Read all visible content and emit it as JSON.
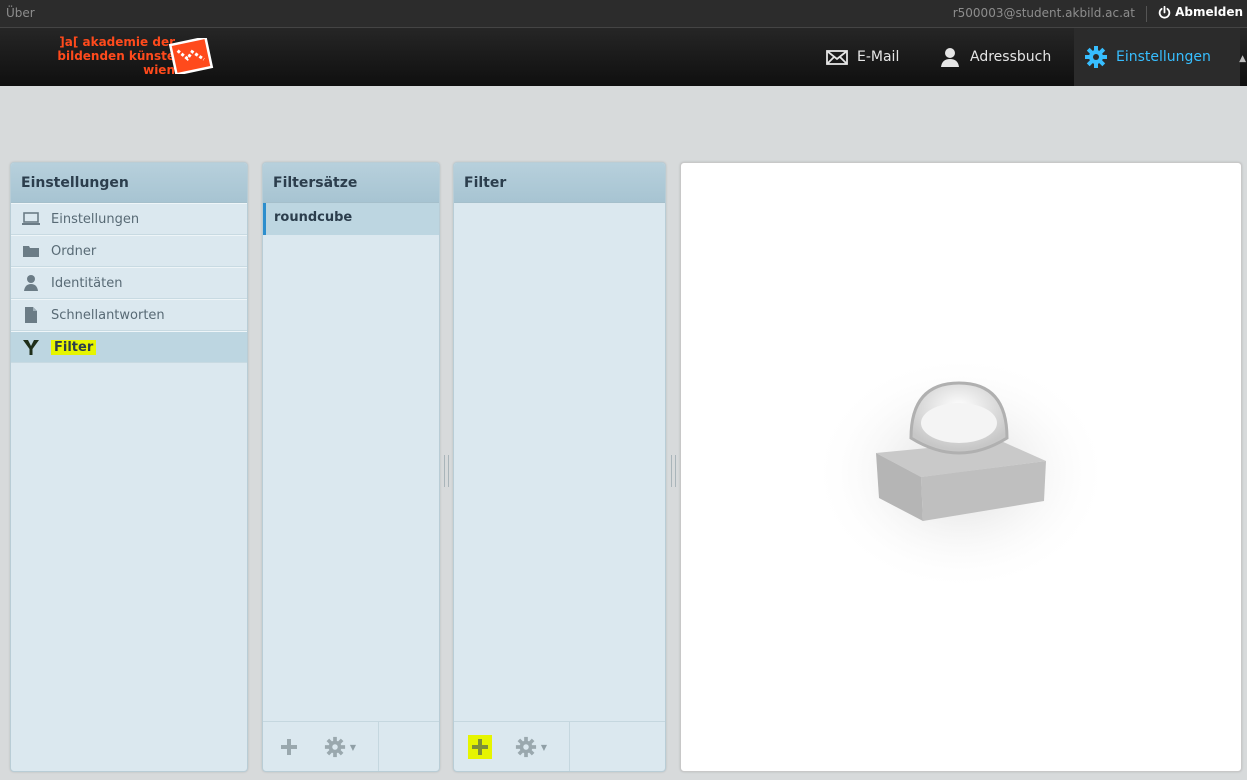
{
  "topbar": {
    "about_label": "Über",
    "user_email": "r500003@student.akbild.ac.at",
    "logout_label": "Abmelden"
  },
  "logo": {
    "text_line1": "]a[ akademie der",
    "text_line2": "bildenden künste",
    "text_line3": "wien"
  },
  "header_nav": [
    {
      "label": "E-Mail",
      "icon": "mail-icon"
    },
    {
      "label": "Adressbuch",
      "icon": "contacts-icon"
    },
    {
      "label": "Einstellungen",
      "icon": "gear-icon",
      "active": true
    }
  ],
  "settings_panel": {
    "title": "Einstellungen",
    "items": [
      {
        "label": "Einstellungen",
        "icon": "laptop-icon"
      },
      {
        "label": "Ordner",
        "icon": "folder-icon"
      },
      {
        "label": "Identitäten",
        "icon": "person-icon"
      },
      {
        "label": "Schnellantworten",
        "icon": "document-icon"
      },
      {
        "label": "Filter",
        "icon": "filter-icon",
        "selected": true
      }
    ]
  },
  "filtersets_panel": {
    "title": "Filtersätze",
    "items": [
      {
        "label": "roundcube",
        "selected": true
      }
    ]
  },
  "filters_panel": {
    "title": "Filter"
  },
  "colors": {
    "accent": "#37beff",
    "brand": "#ff4a1c",
    "highlight": "#e6f500",
    "panel_bg": "#dbe8ef",
    "panel_header": "#a7c4d2"
  }
}
